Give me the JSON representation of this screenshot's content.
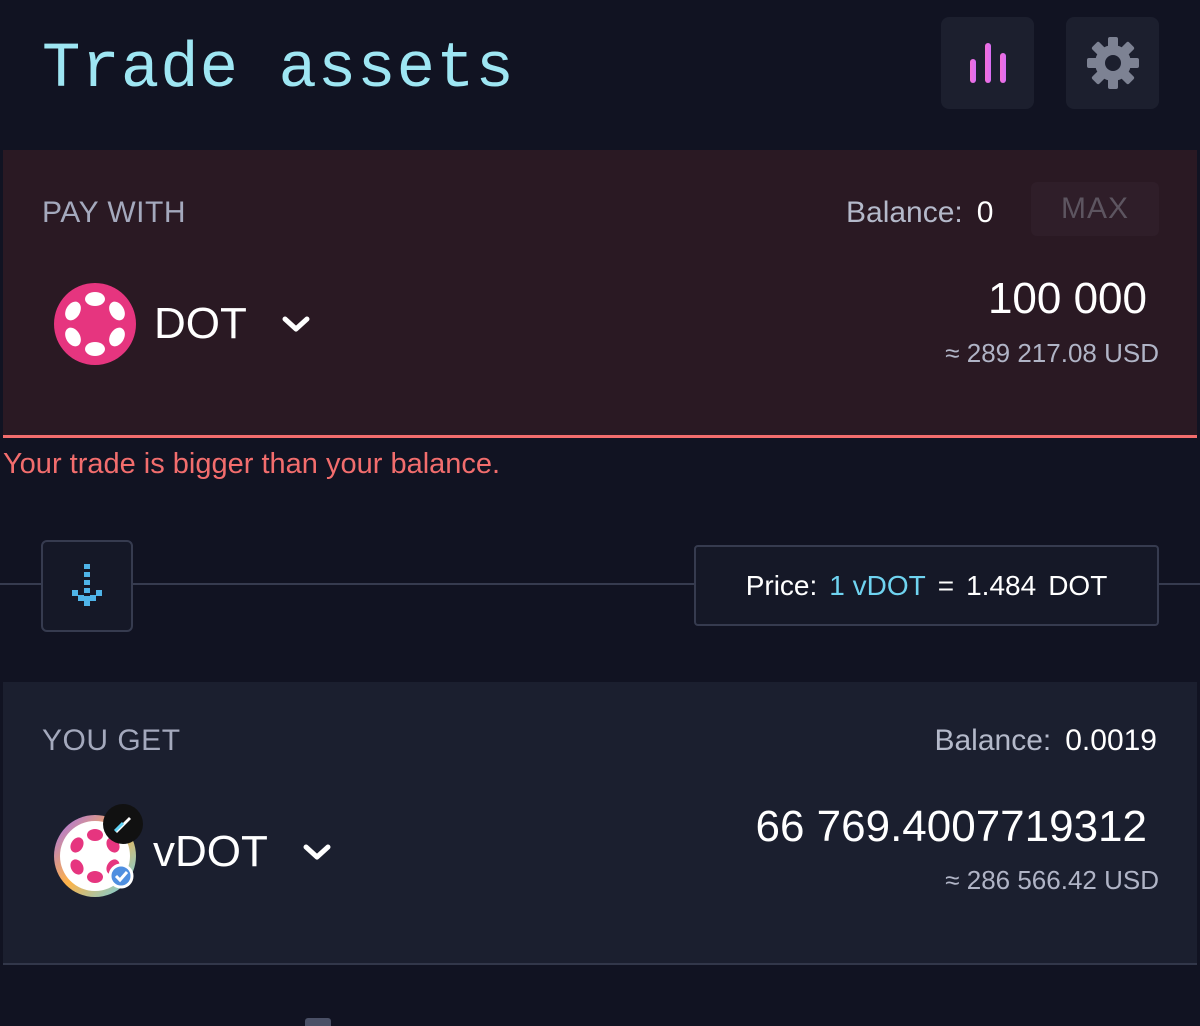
{
  "header": {
    "title": "Trade assets",
    "chart_button_icon": "bar-chart-icon",
    "settings_button_icon": "gear-icon"
  },
  "pay": {
    "label": "PAY WITH",
    "balance_label": "Balance:",
    "balance_value": "0",
    "max_label": "MAX",
    "asset": "DOT",
    "amount": "100 000",
    "usd": "≈ 289 217.08 USD",
    "error": "Your trade is bigger than your balance."
  },
  "swap": {
    "icon": "arrow-down-icon"
  },
  "price": {
    "label": "Price:",
    "base": "1 vDOT",
    "equals": "=",
    "value": "1.484",
    "quote": "DOT"
  },
  "get": {
    "label": "YOU GET",
    "balance_label": "Balance:",
    "balance_value": "0.0019",
    "asset": "vDOT",
    "amount": "66 769.4007719312",
    "usd": "≈ 286 566.42 USD"
  },
  "colors": {
    "accent_title": "#9ee6f3",
    "error": "#f26d6d",
    "dot_pink": "#e6007a",
    "price_accent": "#6fd3f0"
  }
}
